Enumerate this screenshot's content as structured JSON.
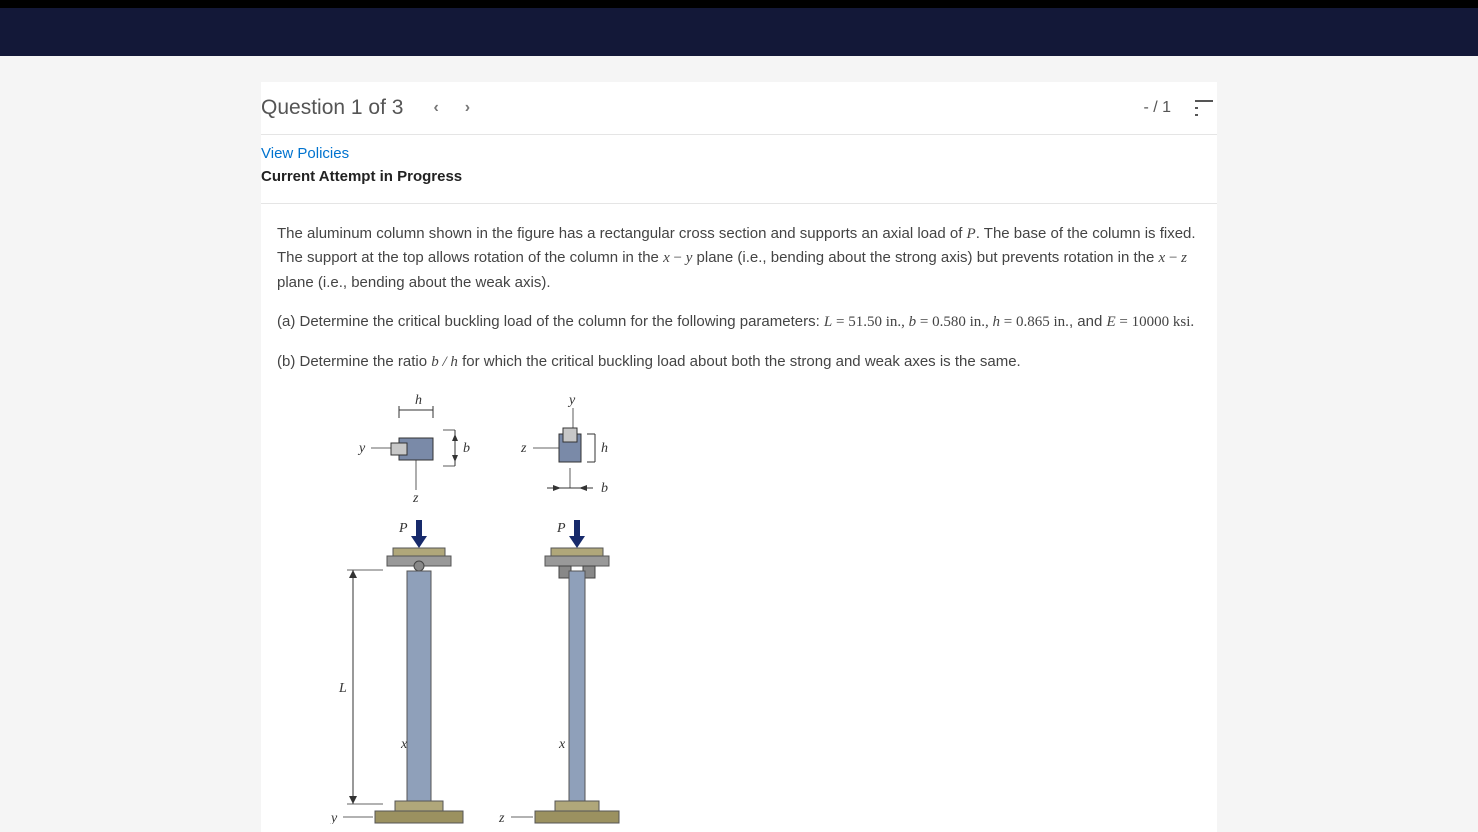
{
  "header": {
    "question_label": "Question 1 of 3",
    "score": "- / 1"
  },
  "meta": {
    "policies_link": "View Policies",
    "status": "Current Attempt in Progress"
  },
  "problem": {
    "intro_pre": "The aluminum column shown in the figure has a rectangular cross section and supports an axial load of ",
    "intro_mid": ". The base of the column is fixed. The support at the top allows rotation of the column in the ",
    "intro_plane1a": "x",
    "intro_plane1b": "y",
    "intro_mid2": " plane (i.e., bending about the strong axis) but prevents rotation in the ",
    "intro_plane2a": "x",
    "intro_plane2b": "z",
    "intro_end": " plane (i.e., bending about the weak axis).",
    "part_a_pre": "(a) Determine the critical buckling load of the column for the following parameters: ",
    "L_sym": "L",
    "L_val": " = 51.50 in.",
    "b_sym": "b",
    "b_val": " = 0.580 in.",
    "h_sym": "h",
    "h_val": " = 0.865 in.",
    "and": ", and ",
    "E_sym": "E",
    "E_val": " = 10000 ksi.",
    "part_b_pre": "(b) Determine the ratio ",
    "ratio": "b / h",
    "part_b_post": " for which the critical buckling load about both the strong and weak axes is the same."
  },
  "figure": {
    "labels": {
      "h": "h",
      "b": "b",
      "y": "y",
      "z": "z",
      "x": "x",
      "P": "P",
      "L": "L"
    }
  }
}
